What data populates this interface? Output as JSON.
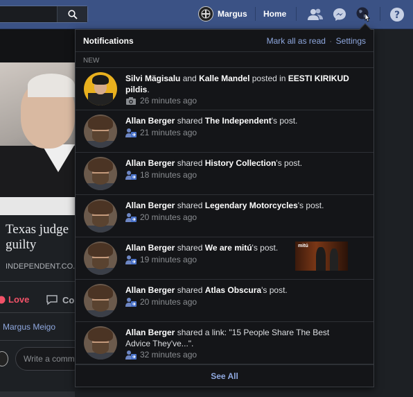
{
  "topbar": {
    "profile_name": "Margus",
    "home_label": "Home"
  },
  "feed": {
    "title": "Texas judge\nguilty",
    "source": "INDEPENDENT.CO.UK",
    "love_label": "Love",
    "comment_label": "Co",
    "liker": "Margus Meigo",
    "write_placeholder": "Write a comm"
  },
  "panel": {
    "title": "Notifications",
    "mark_all": "Mark all as read",
    "separator": "·",
    "settings": "Settings",
    "section": "NEW",
    "see_all": "See All",
    "items": [
      {
        "pre": "",
        "actor": "Silvi Mägisalu",
        "mid1": " and ",
        "actor2": "Kalle Mandel",
        "mid2": " posted in ",
        "target": "EESTI KIRIKUD pildis",
        "post": ".",
        "time": "26 minutes ago",
        "icon": "camera-icon"
      },
      {
        "actor": "Allan Berger",
        "mid": " shared ",
        "target": "The Independent",
        "post": "'s post.",
        "time": "21 minutes ago",
        "icon": "share-icon"
      },
      {
        "actor": "Allan Berger",
        "mid": " shared ",
        "target": "History Collection",
        "post": "'s post.",
        "time": "18 minutes ago",
        "icon": "share-icon"
      },
      {
        "actor": "Allan Berger",
        "mid": " shared ",
        "target": "Legendary Motorcycles",
        "post": "'s post.",
        "time": "20 minutes ago",
        "icon": "share-icon"
      },
      {
        "actor": "Allan Berger",
        "mid": " shared ",
        "target": "We are mitú",
        "post": "'s post.",
        "time": "19 minutes ago",
        "icon": "share-icon",
        "thumb_label": "mitú"
      },
      {
        "actor": "Allan Berger",
        "mid": " shared ",
        "target": "Atlas Obscura",
        "post": "'s post.",
        "time": "20 minutes ago",
        "icon": "share-icon"
      },
      {
        "actor": "Allan Berger",
        "mid": " shared a link: \"15 People Share The Best Advice They've...\".",
        "time": "32 minutes ago",
        "icon": "share-icon"
      }
    ]
  }
}
